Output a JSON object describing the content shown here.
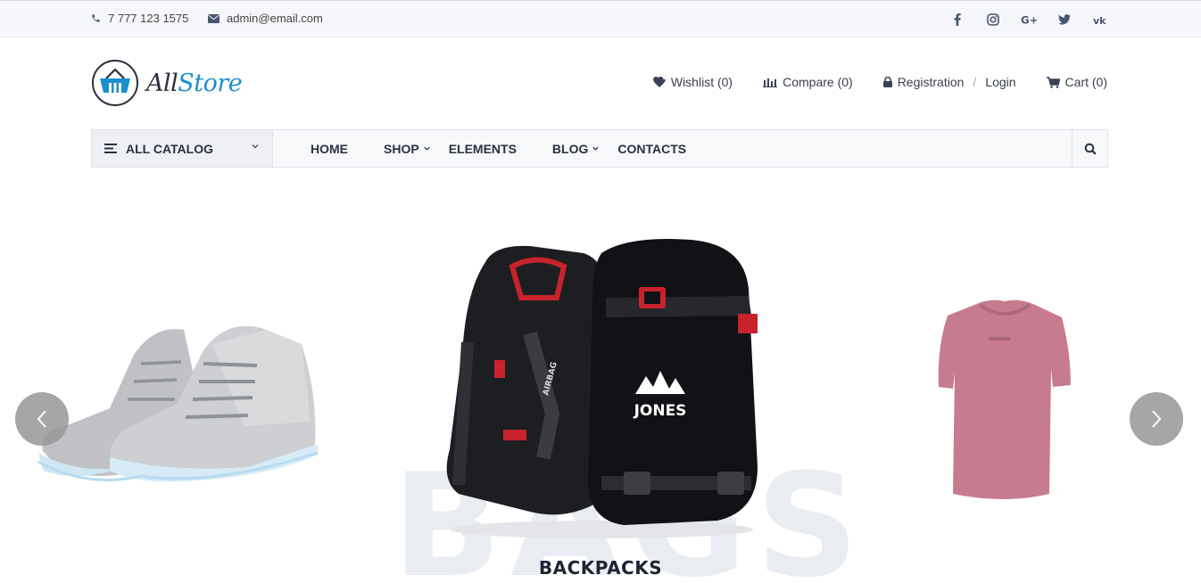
{
  "topbar": {
    "phone": "7 777 123 1575",
    "email": "admin@email.com",
    "socials": [
      "facebook-icon",
      "instagram-icon",
      "google-plus-icon",
      "twitter-icon",
      "vk-icon"
    ]
  },
  "brand": {
    "name_part1": "All",
    "name_part2": "Store",
    "accent_color": "#1a8fcf"
  },
  "header_links": {
    "wishlist": "Wishlist (0)",
    "compare": "Compare (0)",
    "registration": "Registration",
    "separator": "/",
    "login": "Login",
    "cart": "Cart (0)"
  },
  "nav": {
    "catalog_label": "ALL CATALOG",
    "items": [
      {
        "label": "HOME",
        "has_dropdown": false
      },
      {
        "label": "SHOP",
        "has_dropdown": true
      },
      {
        "label": "ELEMENTS",
        "has_dropdown": false
      },
      {
        "label": "BLOG",
        "has_dropdown": true
      },
      {
        "label": "CONTACTS",
        "has_dropdown": false
      }
    ]
  },
  "slider": {
    "background_word": "BAGS",
    "caption": "BACKPACKS",
    "backpack_brand": "JONES",
    "backpack_strap_text": "AIRBAG"
  }
}
